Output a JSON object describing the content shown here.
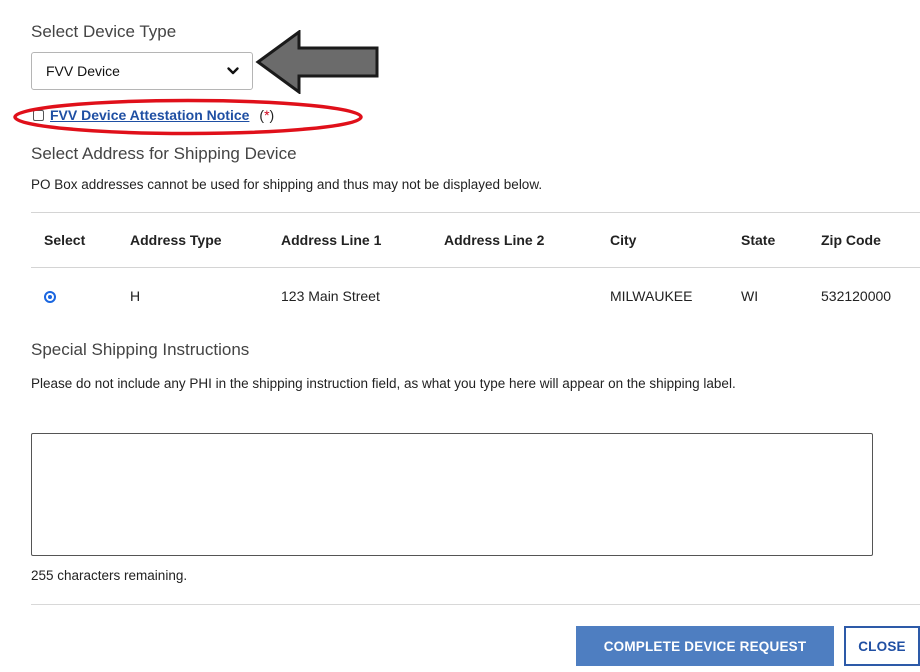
{
  "device_type": {
    "heading": "Select Device Type",
    "selected": "FVV Device"
  },
  "attestation": {
    "link_text": "FVV Device Attestation Notice",
    "required_open": "(",
    "required_star": "*",
    "required_close": ")"
  },
  "address": {
    "heading": "Select Address for Shipping Device",
    "note": "PO Box addresses cannot be used for shipping and thus may not be displayed below.",
    "columns": [
      "Select",
      "Address Type",
      "Address Line 1",
      "Address Line 2",
      "City",
      "State",
      "Zip Code"
    ],
    "rows": [
      {
        "type": "H",
        "line1": "123 Main Street",
        "line2": "",
        "city": "MILWAUKEE",
        "state": "WI",
        "zip": "532120000",
        "selected": true
      }
    ]
  },
  "shipping": {
    "heading": "Special Shipping Instructions",
    "note": "Please do not include any PHI in the shipping instruction field, as what you type here will appear on the shipping label.",
    "value": "",
    "remaining": "255 characters remaining."
  },
  "buttons": {
    "complete": "COMPLETE DEVICE REQUEST",
    "close": "CLOSE"
  },
  "colors": {
    "link": "#1f4fa3",
    "primary_button": "#4e7ec1",
    "annotation_oval": "#e0101a",
    "annotation_arrow": "#6b6b6b",
    "radio": "#1a66e0"
  },
  "icons": {
    "dropdown": "chevron-down-icon",
    "radio": "radio-selected-icon",
    "annotation_arrow": "left-arrow-annotation",
    "annotation_oval": "highlight-oval-annotation"
  }
}
